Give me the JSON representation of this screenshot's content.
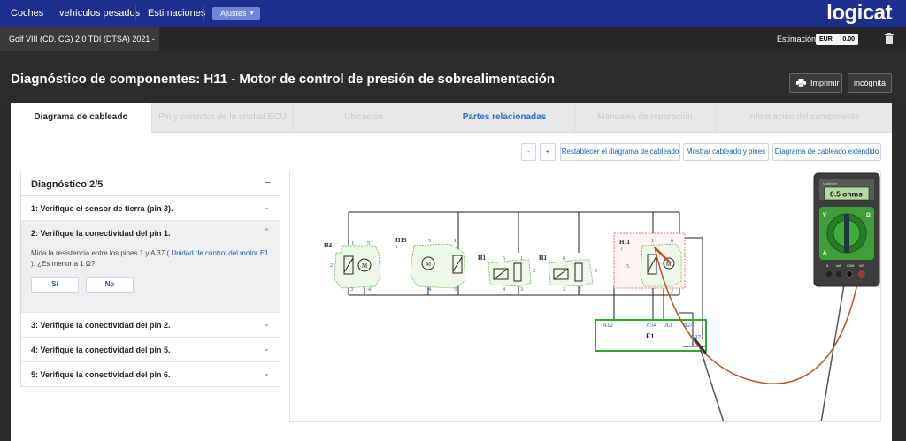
{
  "nav": {
    "items": [
      "Coches",
      "vehículos pesados",
      "Estimaciones"
    ],
    "ajustes": "Ajustes",
    "logo": "logicat"
  },
  "vehicle": {
    "tab": "Golf VIII (CD, CG) 2.0 TDI (DTSA) 2021 - ...",
    "estimation_label": "Estimación",
    "currency": "EUR",
    "amount": "0.00"
  },
  "header": {
    "title": "Diagnóstico de componentes: H11 - Motor de control de presión de sobrealimentación",
    "print": "Imprimir",
    "incognito": "incógnita"
  },
  "tabs": [
    "Diagrama de cableado",
    "Pin y conector de la unidad ECU",
    "Ubicación",
    "Partes relacionadas",
    "Manuales de reparación",
    "Información del componente"
  ],
  "toolbar": {
    "minus": "-",
    "plus": "+",
    "reset": "Restablecer el diagrama de cableado",
    "show_pins": "Mostrar cableado y pines",
    "extended": "Diagrama de cableado extendido"
  },
  "diagnosis": {
    "title": "Diagnóstico 2/5",
    "collapse": "−",
    "steps": [
      "1: Verifique el sensor de tierra (pin 3).",
      "2: Verifique la conectividad del pin 1.",
      "3: Verifique la conectividad del pin 2.",
      "4: Verifique la conectividad del pin 5.",
      "5: Verifique la conectividad del pin 6."
    ],
    "desc_pre": "Mida la resistencia entre los pines 1 y A 37 (",
    "desc_link": " Unidad de control del motor E1 ",
    "desc_post": "). ¿Es menor a 1 Ω?",
    "yes": "Sí",
    "no": "No"
  },
  "wiring": {
    "components": [
      "H4",
      "H19",
      "H1",
      "H1",
      "H11",
      "E1"
    ],
    "component_numbers": [
      "1",
      "1",
      "1",
      "1",
      "1"
    ],
    "h4_pins": [
      "1",
      "5",
      "2",
      "3",
      "4"
    ],
    "h19_pins": [
      "5",
      "1",
      "4",
      "3"
    ],
    "h1a_pins": [
      "5",
      "1",
      "2",
      "4",
      "3"
    ],
    "h1b_pins": [
      "6",
      "1",
      "5",
      "3",
      "2"
    ],
    "h11_pins": [
      "1",
      "6",
      "5",
      "3",
      "2"
    ],
    "ecu_pins": [
      "A12",
      "A54",
      "A3",
      "A24",
      "A37"
    ],
    "meter_brand": "Multimeter",
    "meter_reading": "0.5 ohms",
    "meter_labels": [
      "V",
      "Ω",
      "A",
      "A",
      "mA",
      "COM",
      "V/Ω"
    ]
  },
  "colors": {
    "nav_bg": "#1d2f8c",
    "accent_link": "#1f5ab4",
    "component_green": "#6dbf5b",
    "ecu_green": "#2ea832",
    "highlight_red": "#e04a4a",
    "probe_red": "#b8532a",
    "meter_green": "#3f9e3a"
  },
  "icons": {
    "ajustes": "chevron-down-icon",
    "trash": "trash-icon",
    "print": "printer-icon",
    "collapse": "minus-icon",
    "expand": "chevron-down-icon",
    "collapse_step": "chevron-up-icon"
  }
}
